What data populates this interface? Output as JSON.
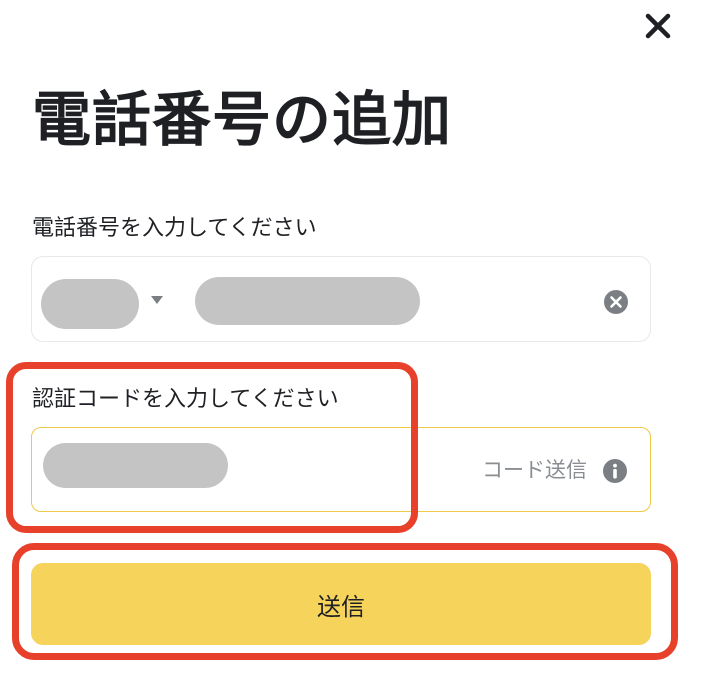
{
  "dialog": {
    "title": "電話番号の追加",
    "close_icon": "close-icon"
  },
  "phone": {
    "label": "電話番号を入力してください",
    "country_code_value": "",
    "phone_value": "",
    "caret_icon": "caret-down-icon",
    "clear_icon": "clear-circle-icon"
  },
  "code": {
    "label": "認証コードを入力してください",
    "code_value": "",
    "send_code_label": "コード送信",
    "info_icon": "info-icon"
  },
  "submit": {
    "label": "送信"
  },
  "colors": {
    "accent": "#f6d35b",
    "input_focus_border": "#f0c84a",
    "redaction_gray": "#c4c4c4",
    "annotation_red": "#e8412b"
  }
}
